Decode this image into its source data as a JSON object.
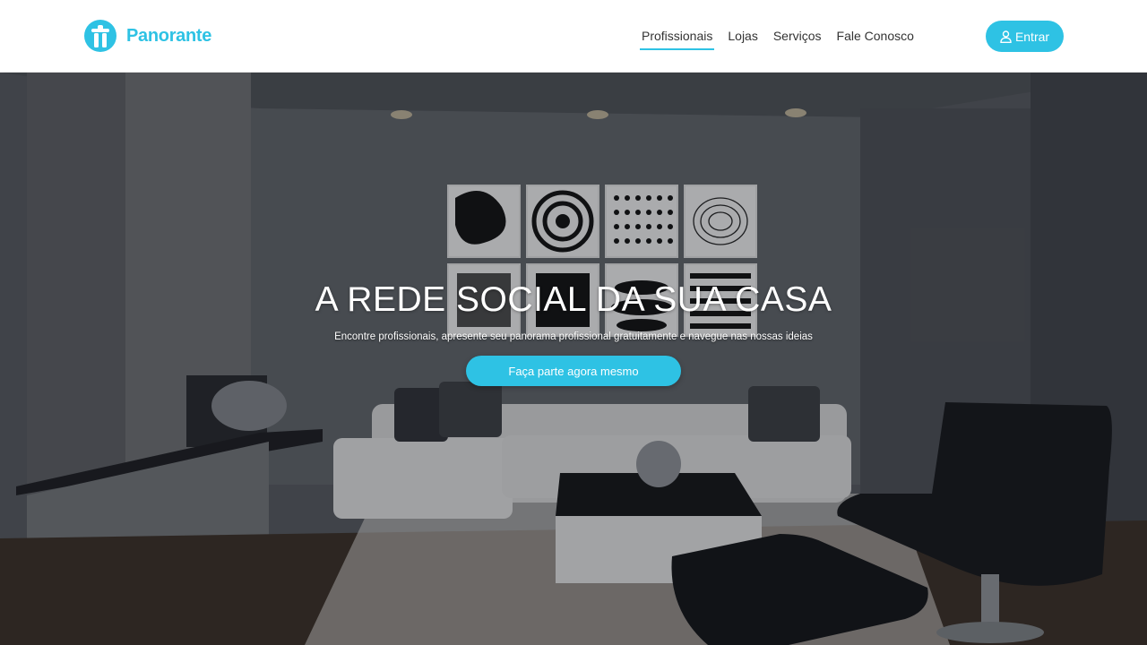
{
  "brand": {
    "name": "Panorante",
    "color": "#2ec2e4",
    "logo_icon": "panorante-logo-icon"
  },
  "nav": {
    "items": [
      {
        "label": "Profissionais",
        "active": true
      },
      {
        "label": "Lojas",
        "active": false
      },
      {
        "label": "Serviços",
        "active": false
      },
      {
        "label": "Fale Conosco",
        "active": false
      }
    ],
    "login_label": "Entrar",
    "login_icon": "user-icon"
  },
  "hero": {
    "title": "A REDE SOCIAL DA SUA CASA",
    "subtitle": "Encontre profissionais, apresente seu panorama profissional gratuitamente e navegue nas nossas ideias",
    "cta_label": "Faça parte agora mesmo",
    "background": "living-room-photo"
  }
}
